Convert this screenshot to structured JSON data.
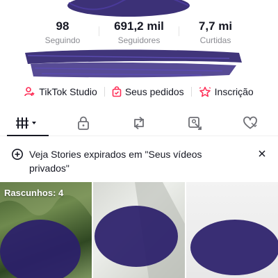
{
  "stats": [
    {
      "value": "98",
      "label": "Seguindo"
    },
    {
      "value": "691,2 mil",
      "label": "Seguidores"
    },
    {
      "value": "7,7 mi",
      "label": "Curtidas"
    }
  ],
  "links": {
    "studio": "TikTok Studio",
    "orders": "Seus pedidos",
    "subscription": "Inscrição"
  },
  "tabs": [
    {
      "icon": "grid-icon",
      "active": true
    },
    {
      "icon": "lock-icon",
      "active": false
    },
    {
      "icon": "repost-icon",
      "active": false
    },
    {
      "icon": "tagged-icon",
      "active": false
    },
    {
      "icon": "liked-icon",
      "active": false
    }
  ],
  "banner": {
    "text": "Veja Stories expirados em \"Seus vídeos privados\""
  },
  "grid": {
    "drafts_label": "Rascunhos: 4"
  },
  "colors": {
    "accent": "#fe2c55",
    "scribble": "#2b1f6b",
    "text": "#161823",
    "muted": "#8a8b91"
  }
}
